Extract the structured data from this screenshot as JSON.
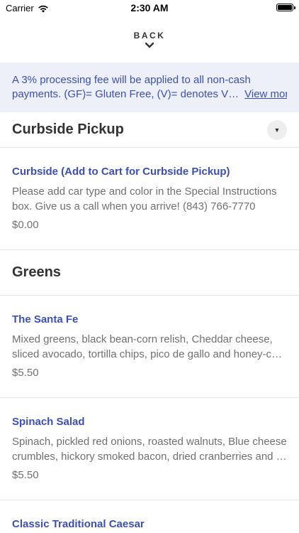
{
  "status_bar": {
    "carrier": "Carrier",
    "time": "2:30 AM"
  },
  "nav": {
    "back_label": "BACK"
  },
  "notice": {
    "line1": "A 3% processing fee will be applied to all non-cash",
    "line2": "payments. (GF)= Gluten Free, (V)= denotes V…",
    "view_more": "View more"
  },
  "sections": [
    {
      "title": "Curbside Pickup",
      "items": [
        {
          "name": "Curbside (Add to Cart for Curbside Pickup)",
          "desc_line1": "Please add car type and color in the Special Instructions",
          "desc_line2": "box. Give us a call when you arrive! (843) 766-7770",
          "price": "$0.00"
        }
      ]
    },
    {
      "title": "Greens",
      "items": [
        {
          "name": "The Santa Fe",
          "desc_line1": "Mixed greens, black bean-corn relish, Cheddar cheese,",
          "desc_line2": "sliced avocado, tortilla chips, pico de gallo and honey-ch…",
          "price": "$5.50"
        },
        {
          "name": "Spinach Salad",
          "desc_line1": "Spinach, pickled red onions, roasted walnuts, Blue cheese",
          "desc_line2": "crumbles, hickory smoked bacon, dried cranberries and r…",
          "price": "$5.50"
        },
        {
          "name": "Classic Traditional Caesar"
        }
      ]
    }
  ]
}
